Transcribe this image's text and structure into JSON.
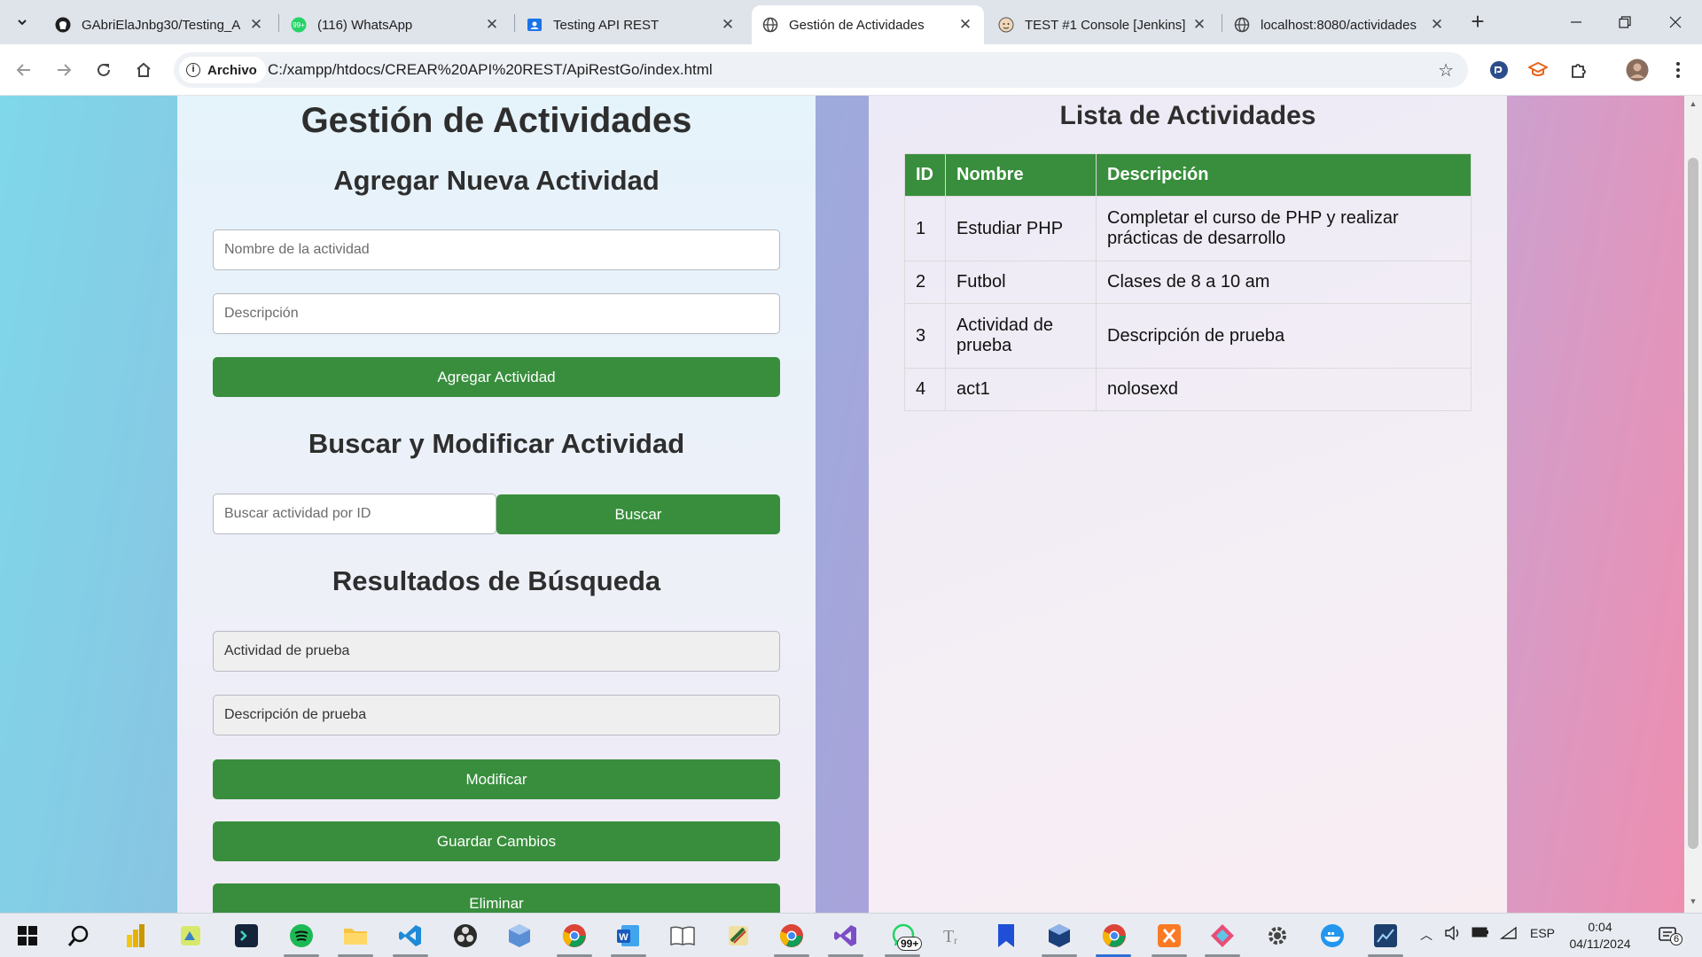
{
  "browser": {
    "tabs": [
      {
        "title": "GAbriElaJnbg30/Testing_A",
        "icon": "github-icon"
      },
      {
        "title": "(116) WhatsApp",
        "icon": "whatsapp-icon"
      },
      {
        "title": "Testing API REST",
        "icon": "contact-icon"
      },
      {
        "title": "Gestión de Actividades",
        "icon": "globe-icon",
        "active": true
      },
      {
        "title": "TEST #1 Console [Jenkins]",
        "icon": "jenkins-icon"
      },
      {
        "title": "localhost:8080/actividades",
        "icon": "globe-icon"
      }
    ],
    "address": {
      "chip_label": "Archivo",
      "url": "C:/xampp/htdocs/CREAR%20API%20REST/ApiRestGo/index.html"
    }
  },
  "left_panel": {
    "title": "Gestión de Actividades",
    "add_section": {
      "heading": "Agregar Nueva Actividad",
      "name_placeholder": "Nombre de la actividad",
      "desc_placeholder": "Descripción",
      "add_button": "Agregar Actividad"
    },
    "search_section": {
      "heading": "Buscar y Modificar Actividad",
      "id_placeholder": "Buscar actividad por ID",
      "search_button": "Buscar"
    },
    "results_section": {
      "heading": "Resultados de Búsqueda",
      "name_value": "Actividad de prueba",
      "desc_value": "Descripción de prueba",
      "modify_button": "Modificar",
      "save_button": "Guardar Cambios",
      "delete_button": "Eliminar"
    }
  },
  "right_panel": {
    "title": "Lista de Actividades",
    "columns": [
      "ID",
      "Nombre",
      "Descripción"
    ],
    "rows": [
      [
        "1",
        "Estudiar PHP",
        "Completar el curso de PHP y realizar prácticas de desarrollo"
      ],
      [
        "2",
        "Futbol",
        "Clases de 8 a 10 am"
      ],
      [
        "3",
        "Actividad de prueba",
        "Descripción de prueba"
      ],
      [
        "4",
        "act1",
        "nolosexd"
      ]
    ]
  },
  "taskbar": {
    "whatsapp_badge": "99+",
    "language": "ESP",
    "time": "0:04",
    "date": "04/11/2024",
    "notifications": "6"
  },
  "colors": {
    "accent_green": "#388e3c",
    "heading_text": "#2e2e2e"
  }
}
